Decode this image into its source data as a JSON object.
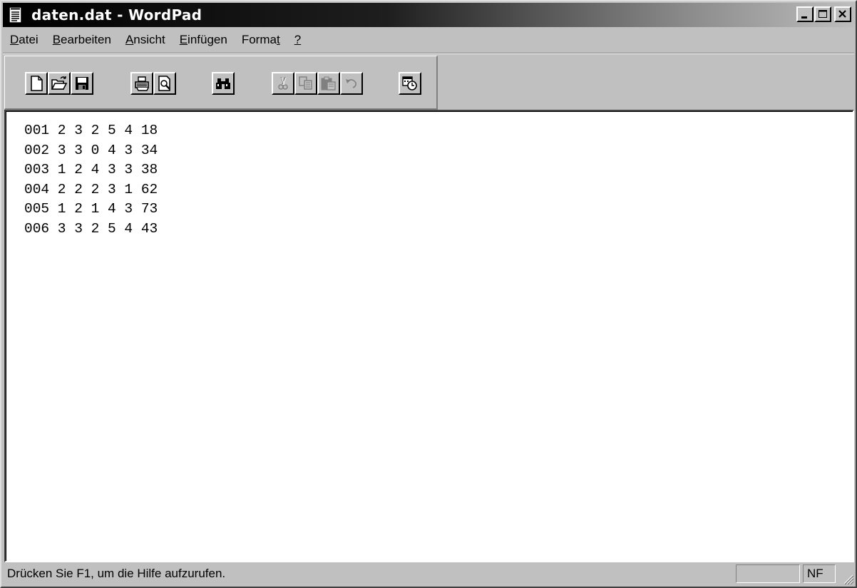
{
  "window": {
    "title": "daten.dat - WordPad"
  },
  "menu": [
    {
      "id": "datei",
      "accel": "D",
      "rest": "atei"
    },
    {
      "id": "bearbeiten",
      "accel": "B",
      "rest": "earbeiten"
    },
    {
      "id": "ansicht",
      "accel": "A",
      "rest": "nsicht"
    },
    {
      "id": "einfuegen",
      "accel": "E",
      "rest": "infügen"
    },
    {
      "id": "format",
      "pre": "Forma",
      "accel": "t",
      "rest": ""
    },
    {
      "id": "help",
      "accel": "?",
      "rest": ""
    }
  ],
  "toolbar": {
    "icons": [
      "new-document-icon",
      "open-folder-icon",
      "save-disk-icon",
      "print-icon",
      "print-preview-icon",
      "find-binoculars-icon",
      "cut-scissors-icon",
      "copy-icon",
      "paste-icon",
      "undo-icon",
      "insert-date-time-icon"
    ],
    "disabled": [
      "cut-scissors-icon",
      "copy-icon",
      "paste-icon",
      "undo-icon"
    ]
  },
  "document": {
    "lines": [
      "001 2 3 2 5 4 18",
      "002 3 3 0 4 3 34",
      "003 1 2 4 3 3 38",
      "004 2 2 2 3 1 62",
      "005 1 2 1 4 3 73",
      "006 3 3 2 5 4 43"
    ]
  },
  "statusbar": {
    "message": "Drücken Sie F1, um die Hilfe aufzurufen.",
    "pane_empty": "",
    "pane_num": "NF"
  },
  "colors": {
    "face": "#c0c0c0",
    "title_active_start": "#000000",
    "title_active_end": "#bdbdbd",
    "document_bg": "#ffffff"
  }
}
